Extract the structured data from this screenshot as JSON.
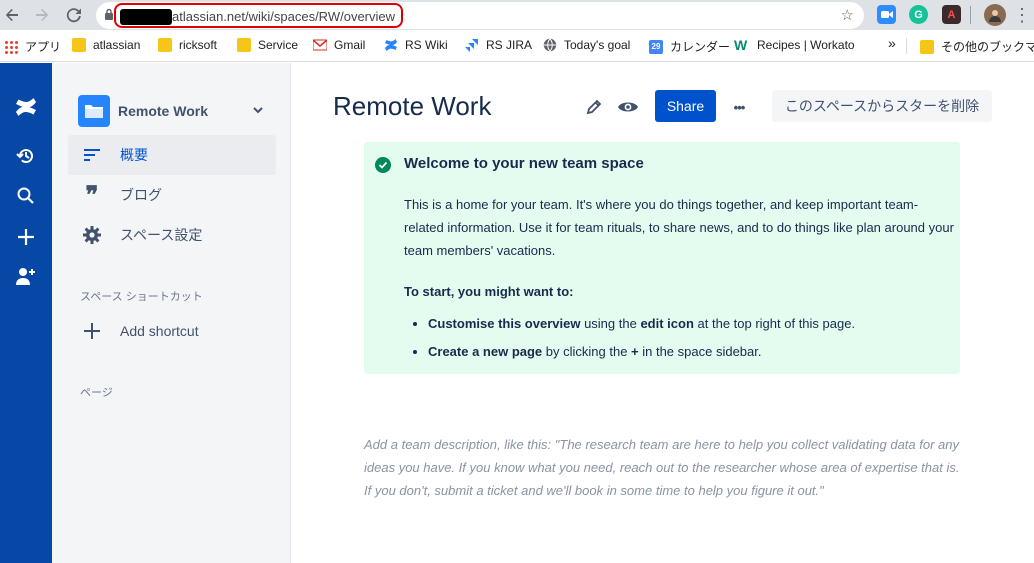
{
  "browser": {
    "url": "atlassian.net/wiki/spaces/RW/overview",
    "ext_grammarly_letter": "G",
    "ext_acrobat_letter": "A"
  },
  "bookmarks": [
    {
      "label": "アプリ",
      "icon": "apps-grid-icon"
    },
    {
      "label": "atlassian",
      "icon": "folder-icon"
    },
    {
      "label": "ricksoft",
      "icon": "folder-icon"
    },
    {
      "label": "Service",
      "icon": "folder-icon"
    },
    {
      "label": "Gmail",
      "icon": "gmail-icon"
    },
    {
      "label": "RS Wiki",
      "icon": "confluence-icon"
    },
    {
      "label": "RS JIRA",
      "icon": "jira-icon"
    },
    {
      "label": "Today's goal",
      "icon": "globe-icon"
    },
    {
      "label": "カレンダー",
      "icon": "calendar-icon",
      "badge": "29"
    },
    {
      "label": "Recipes | Workato",
      "icon": "workato-icon",
      "badge": "W"
    },
    {
      "label": "»",
      "icon": "overflow-icon"
    },
    {
      "label": "その他のブックマーク",
      "icon": "folder-icon"
    }
  ],
  "sidebar": {
    "space_name": "Remote Work",
    "items": [
      {
        "label": "概要",
        "active": true
      },
      {
        "label": "ブログ",
        "active": false
      },
      {
        "label": "スペース設定",
        "active": false
      }
    ],
    "shortcuts_heading": "スペース ショートカット",
    "add_shortcut": "Add shortcut",
    "pages_heading": "ページ"
  },
  "main": {
    "title": "Remote Work",
    "share_label": "Share",
    "more_label": "•••",
    "unstar_label": "このスペースからスターを削除",
    "panel": {
      "title": "Welcome to your new team space",
      "body": "This is a home for your team. It's where you do things together, and keep important team-related information. Use it for team rituals, to share news, and to do things like plan around your team members' vacations.",
      "subheading": "To start, you might want to:",
      "list": [
        {
          "b1": "Customise this overview",
          "t1": " using the ",
          "b2": "edit icon",
          "t2": " at the top right of this page."
        },
        {
          "b1": "Create a new page",
          "t1": " by clicking the ",
          "b2": "+",
          "t2": " in the space sidebar."
        }
      ]
    },
    "placeholder": "Add a team description, like this: \"The research team are here to help you collect validating data for any ideas you have. If you know what you need, reach out to the researcher whose area of expertise that is. If you don't, submit a ticket and we'll book in some time to help you figure it out.\""
  },
  "colors": {
    "rail": "#0747a6",
    "brand_blue": "#0052cc",
    "panel_bg": "#e3fcef",
    "panel_check": "#00875a"
  }
}
